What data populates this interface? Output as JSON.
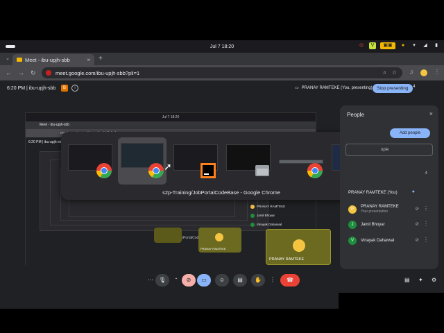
{
  "system": {
    "clock": "Jul 7  18:20"
  },
  "browser": {
    "tab_title": "Meet - ibu-upjh-sbb",
    "url": "meet.google.com/ibu-upjh-sbb?pli=1"
  },
  "meet": {
    "time_code": "6:20 PM  |  ibu-upjh-sbb",
    "presenting_label": "PRANAY RAMTEKE (You, presenting)",
    "stop_label": "Stop presenting",
    "participant_count": "4"
  },
  "picker": {
    "caption": "s2p-Training/JobPortalCodeBase - Google Chrome"
  },
  "people_panel": {
    "title": "People",
    "add_label": "Add people",
    "search_placeholder": "ople",
    "contributors_count": "4",
    "participants": [
      {
        "name": "PRANAY RAMTEKE (You)",
        "sub": "",
        "initial": "P",
        "color": "#f5c542"
      },
      {
        "name": "PRANAY RAMTEKE",
        "sub": "Your presentation",
        "initial": "P",
        "color": "#f5c542"
      },
      {
        "name": "Jamil Bhoyar",
        "sub": "",
        "initial": "J",
        "color": "#1e8e3e"
      },
      {
        "name": "Vinayak Daharwal",
        "sub": "",
        "initial": "V",
        "color": "#1e8e3e"
      }
    ]
  },
  "nested": {
    "clock": "Jul 7  18:20",
    "tab": "Meet - ibu-upjh-sbb",
    "url": "meet.google.com/ibu-upjh-sbb?pli=1",
    "time_code": "6:20 PM  |  ibu-upjh-sbb",
    "caption": "s2p-Training/JobPortalCodeBase - Google Chrome",
    "tile_big_name": "PRANAY RAMTEKE",
    "tile_mid_name": "PRANAY RAMTEKE",
    "people": [
      "PRANAY RAMTEKE",
      "Jamil Bhoyar",
      "Vinayak Daharwal"
    ]
  }
}
